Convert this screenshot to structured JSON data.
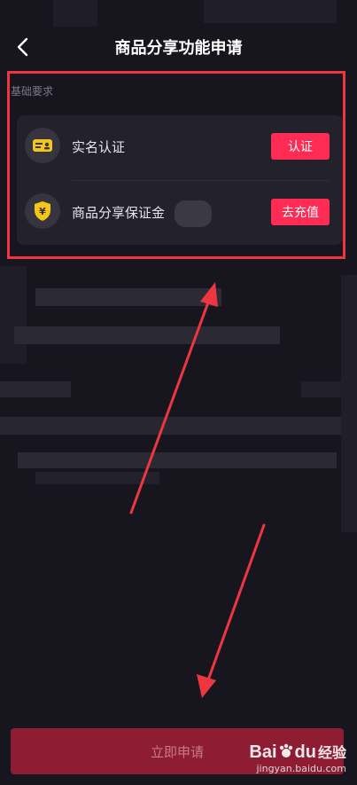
{
  "header": {
    "title": "商品分享功能申请"
  },
  "section": {
    "label": "基础要求"
  },
  "requirements": [
    {
      "label": "实名认证",
      "button": "认证",
      "icon": "id-card-icon"
    },
    {
      "label": "商品分享保证金",
      "button": "去充值",
      "icon": "yuan-shield-icon"
    }
  ],
  "submit": {
    "label": "立即申请"
  },
  "watermark": {
    "logo_text": "Bai",
    "logo_text2": "du",
    "suffix": "经验",
    "url": "jingyan.baidu.com"
  },
  "colors": {
    "accent": "#fe2c55",
    "background": "#17161f",
    "annotation": "#ee3640"
  }
}
